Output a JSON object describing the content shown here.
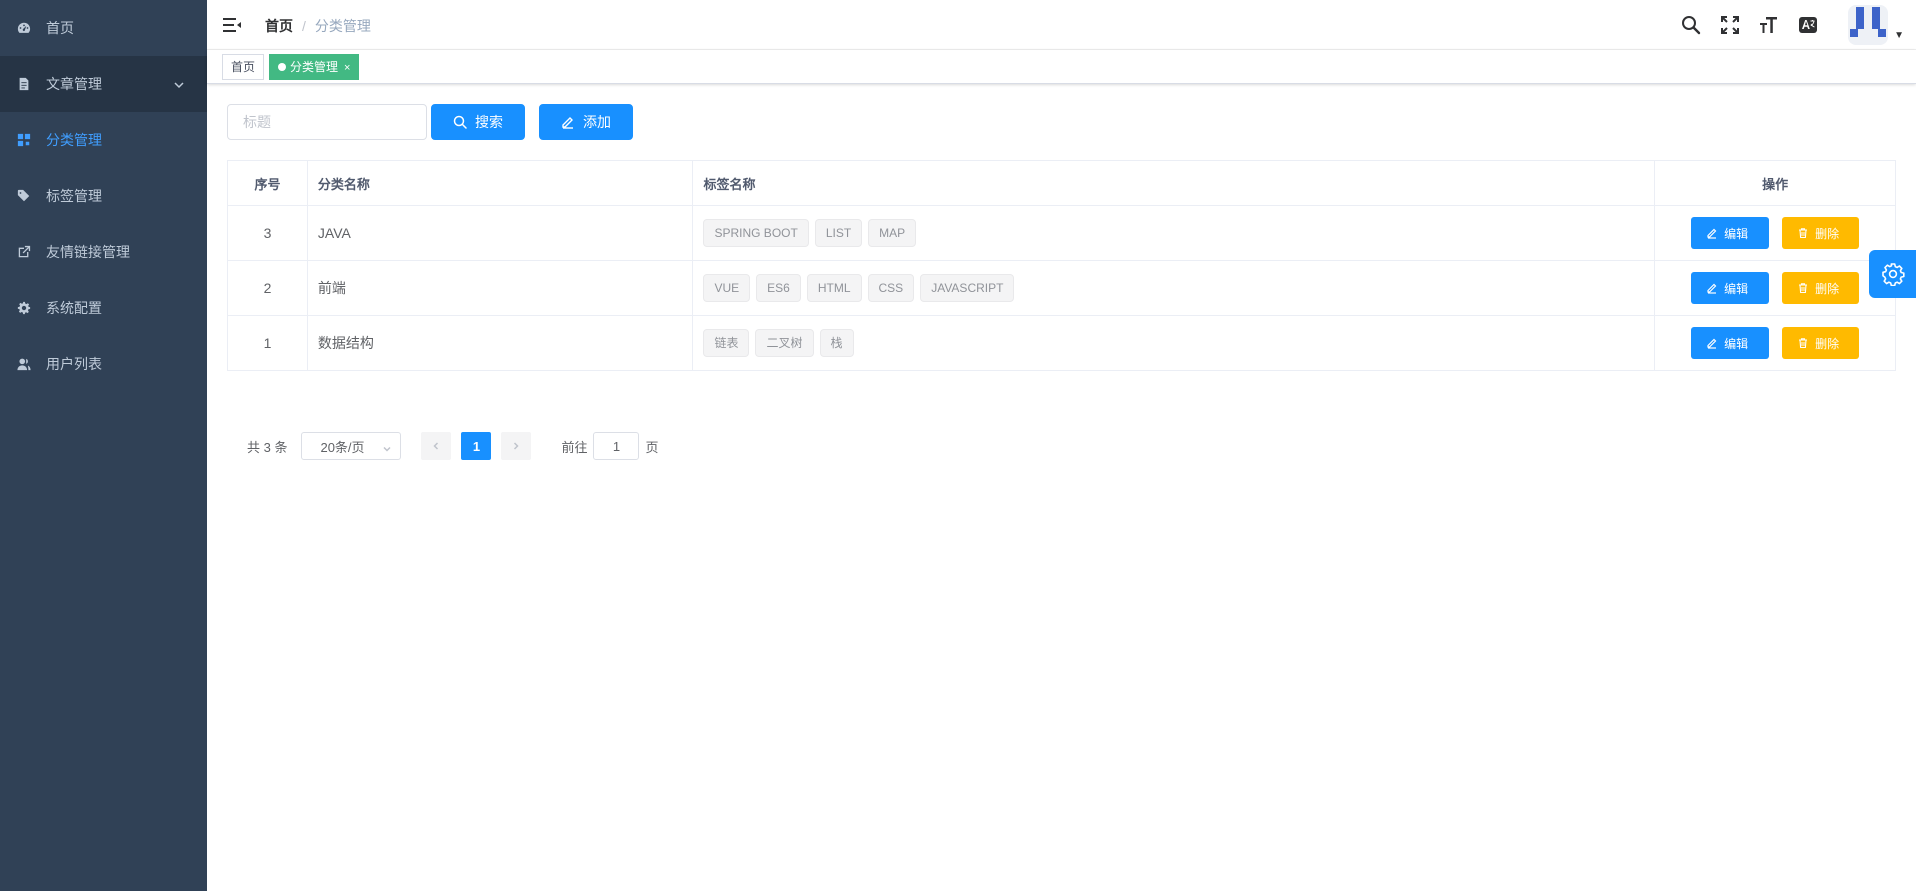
{
  "sidebar": {
    "items": [
      {
        "label": "首页",
        "icon": "dashboard-icon"
      },
      {
        "label": "文章管理",
        "icon": "document-icon"
      },
      {
        "label": "分类管理",
        "icon": "category-icon"
      },
      {
        "label": "标签管理",
        "icon": "tag-icon"
      },
      {
        "label": "友情链接管理",
        "icon": "external-link-icon"
      },
      {
        "label": "系统配置",
        "icon": "gear-icon"
      },
      {
        "label": "用户列表",
        "icon": "user-icon"
      }
    ]
  },
  "navbar": {
    "breadcrumb": {
      "home": "首页",
      "separator": "/",
      "current": "分类管理"
    }
  },
  "tags_view": {
    "home": "首页",
    "active": "分类管理",
    "close": "×"
  },
  "toolbar": {
    "search_placeholder": "标题",
    "search_label": "搜索",
    "add_label": "添加"
  },
  "table": {
    "headers": {
      "index": "序号",
      "name": "分类名称",
      "tags": "标签名称",
      "ops": "操作"
    },
    "rows": [
      {
        "index": "3",
        "name": "JAVA",
        "tags": [
          "SPRING BOOT",
          "LIST",
          "MAP"
        ]
      },
      {
        "index": "2",
        "name": "前端",
        "tags": [
          "VUE",
          "ES6",
          "HTML",
          "CSS",
          "JAVASCRIPT"
        ]
      },
      {
        "index": "1",
        "name": "数据结构",
        "tags": [
          "链表",
          "二叉树",
          "栈"
        ]
      }
    ],
    "edit_label": "编辑",
    "delete_label": "删除"
  },
  "pagination": {
    "total": "共 3 条",
    "page_size": "20条/页",
    "current_page": "1",
    "goto_prefix": "前往",
    "goto_value": "1",
    "goto_suffix": "页"
  },
  "colors": {
    "sidebar_bg": "#304156",
    "primary": "#1890ff",
    "warning": "#ffba00",
    "active_tag": "#42b983"
  }
}
